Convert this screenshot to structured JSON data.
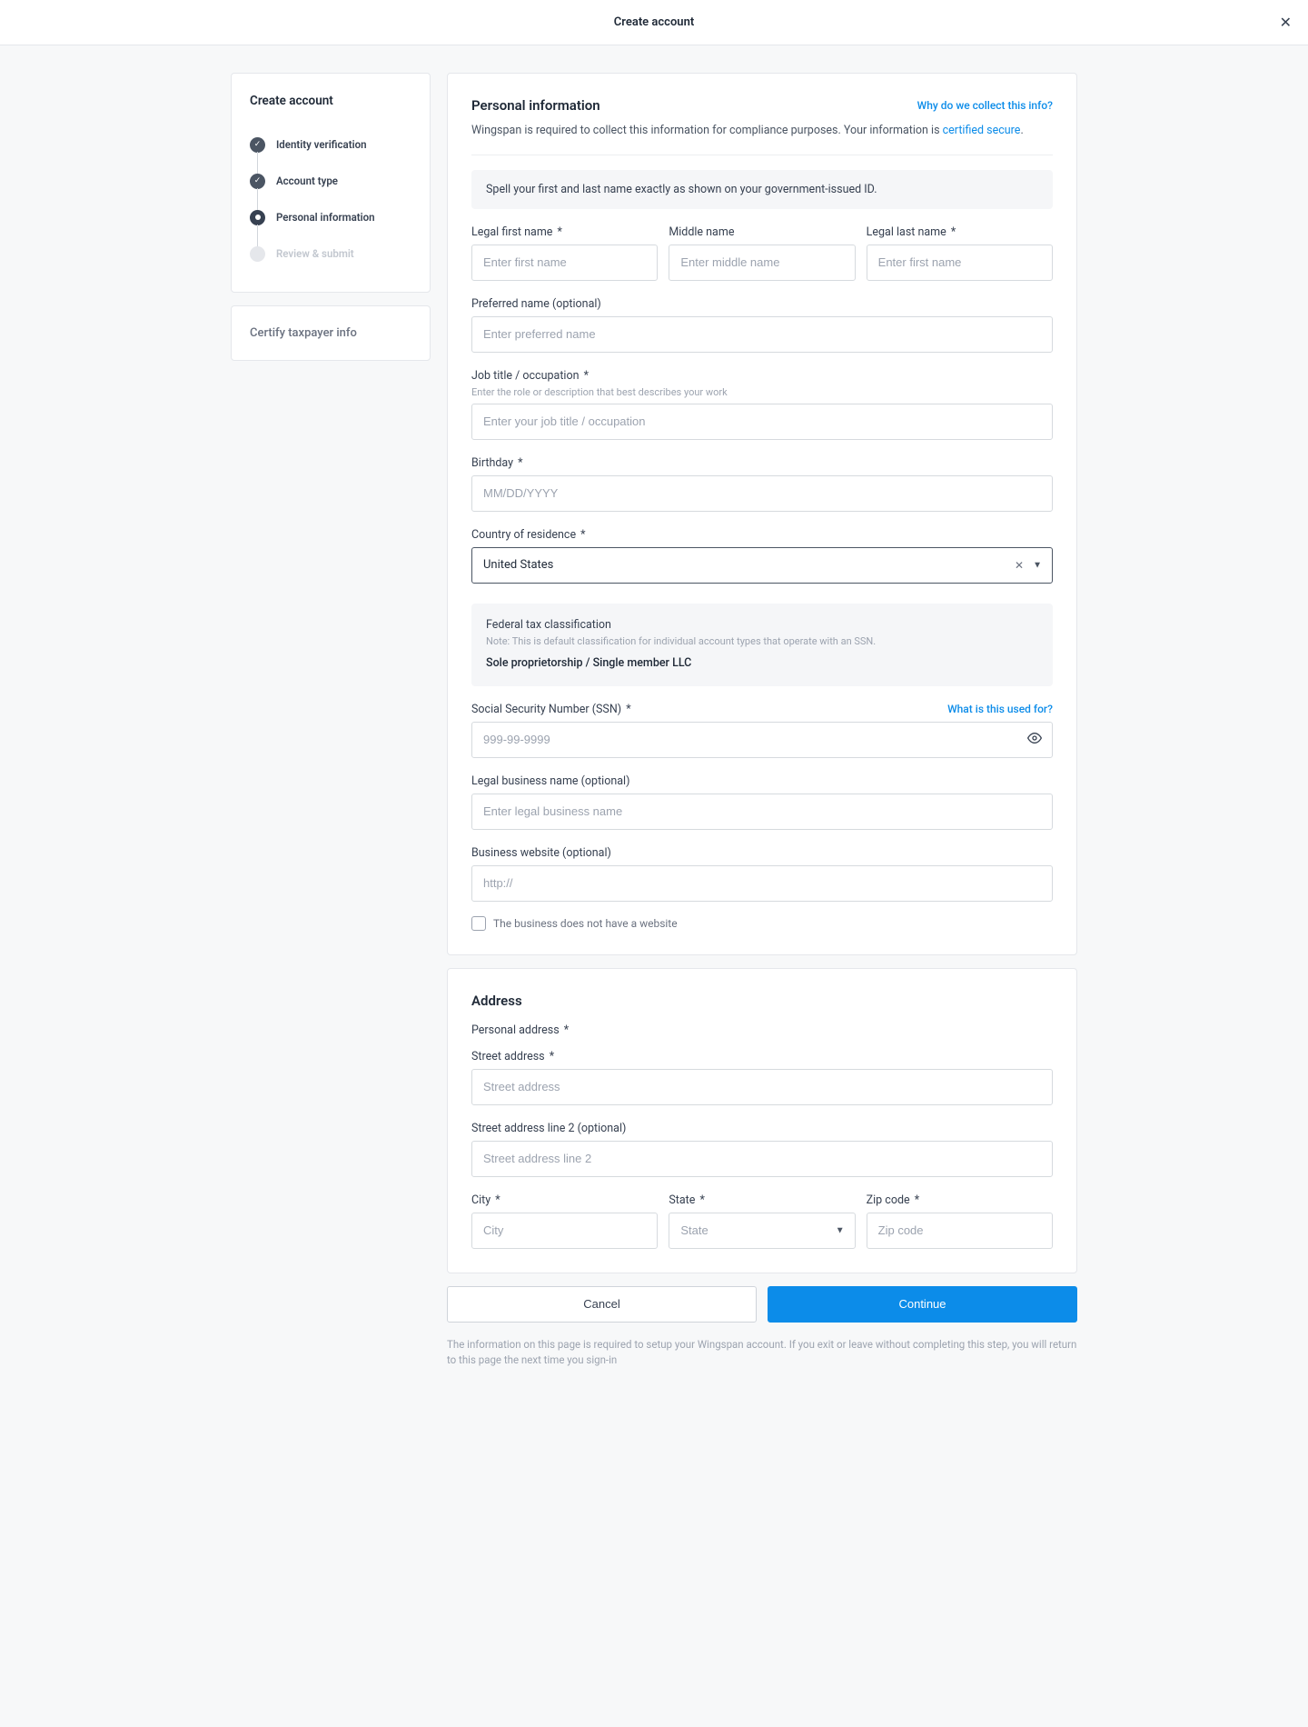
{
  "header": {
    "title": "Create account"
  },
  "sidebar": {
    "card_title": "Create account",
    "steps": [
      {
        "label": "Identity verification",
        "state": "done"
      },
      {
        "label": "Account type",
        "state": "done"
      },
      {
        "label": "Personal information",
        "state": "current"
      },
      {
        "label": "Review & submit",
        "state": "future"
      }
    ],
    "secondary_title": "Certify taxpayer info"
  },
  "personal": {
    "title": "Personal information",
    "why_link": "Why do we collect this info?",
    "desc_prefix": "Wingspan is required to collect this information for compliance purposes. Your information is ",
    "desc_link": "certified secure",
    "desc_suffix": ".",
    "spell_note": "Spell your first and last name exactly as shown on your government-issued ID.",
    "first_label": "Legal first name",
    "first_placeholder": "Enter first name",
    "middle_label": "Middle name",
    "middle_placeholder": "Enter middle name",
    "last_label": "Legal last name",
    "last_placeholder": "Enter first name",
    "preferred_label": "Preferred name (optional)",
    "preferred_placeholder": "Enter preferred name",
    "job_label": "Job title / occupation",
    "job_help": "Enter the role or description that best describes your work",
    "job_placeholder": "Enter your job title / occupation",
    "birthday_label": "Birthday",
    "birthday_placeholder": "MM/DD/YYYY",
    "country_label": "Country of residence",
    "country_value": "United States",
    "fed_title": "Federal tax classification",
    "fed_note": "Note: This is default classification for individual account types that operate with an SSN.",
    "fed_value": "Sole proprietorship / Single member LLC",
    "ssn_label": "Social Security Number (SSN)",
    "ssn_link": "What is this used for?",
    "ssn_placeholder": "999-99-9999",
    "legalbiz_label": "Legal business name (optional)",
    "legalbiz_placeholder": "Enter legal business name",
    "website_label": "Business website (optional)",
    "website_placeholder": "http://",
    "no_website": "The business does not have a website"
  },
  "address": {
    "title": "Address",
    "subtitle": "Personal address",
    "street_label": "Street address",
    "street_placeholder": "Street address",
    "street2_label": "Street address line 2 (optional)",
    "street2_placeholder": "Street address line 2",
    "city_label": "City",
    "city_placeholder": "City",
    "state_label": "State",
    "state_placeholder": "State",
    "zip_label": "Zip code",
    "zip_placeholder": "Zip code"
  },
  "footer": {
    "cancel": "Cancel",
    "continue": "Continue",
    "help": "The information on this page is required to setup your Wingspan account. If you exit or leave without completing this step, you will return to this page the next time you sign-in"
  }
}
